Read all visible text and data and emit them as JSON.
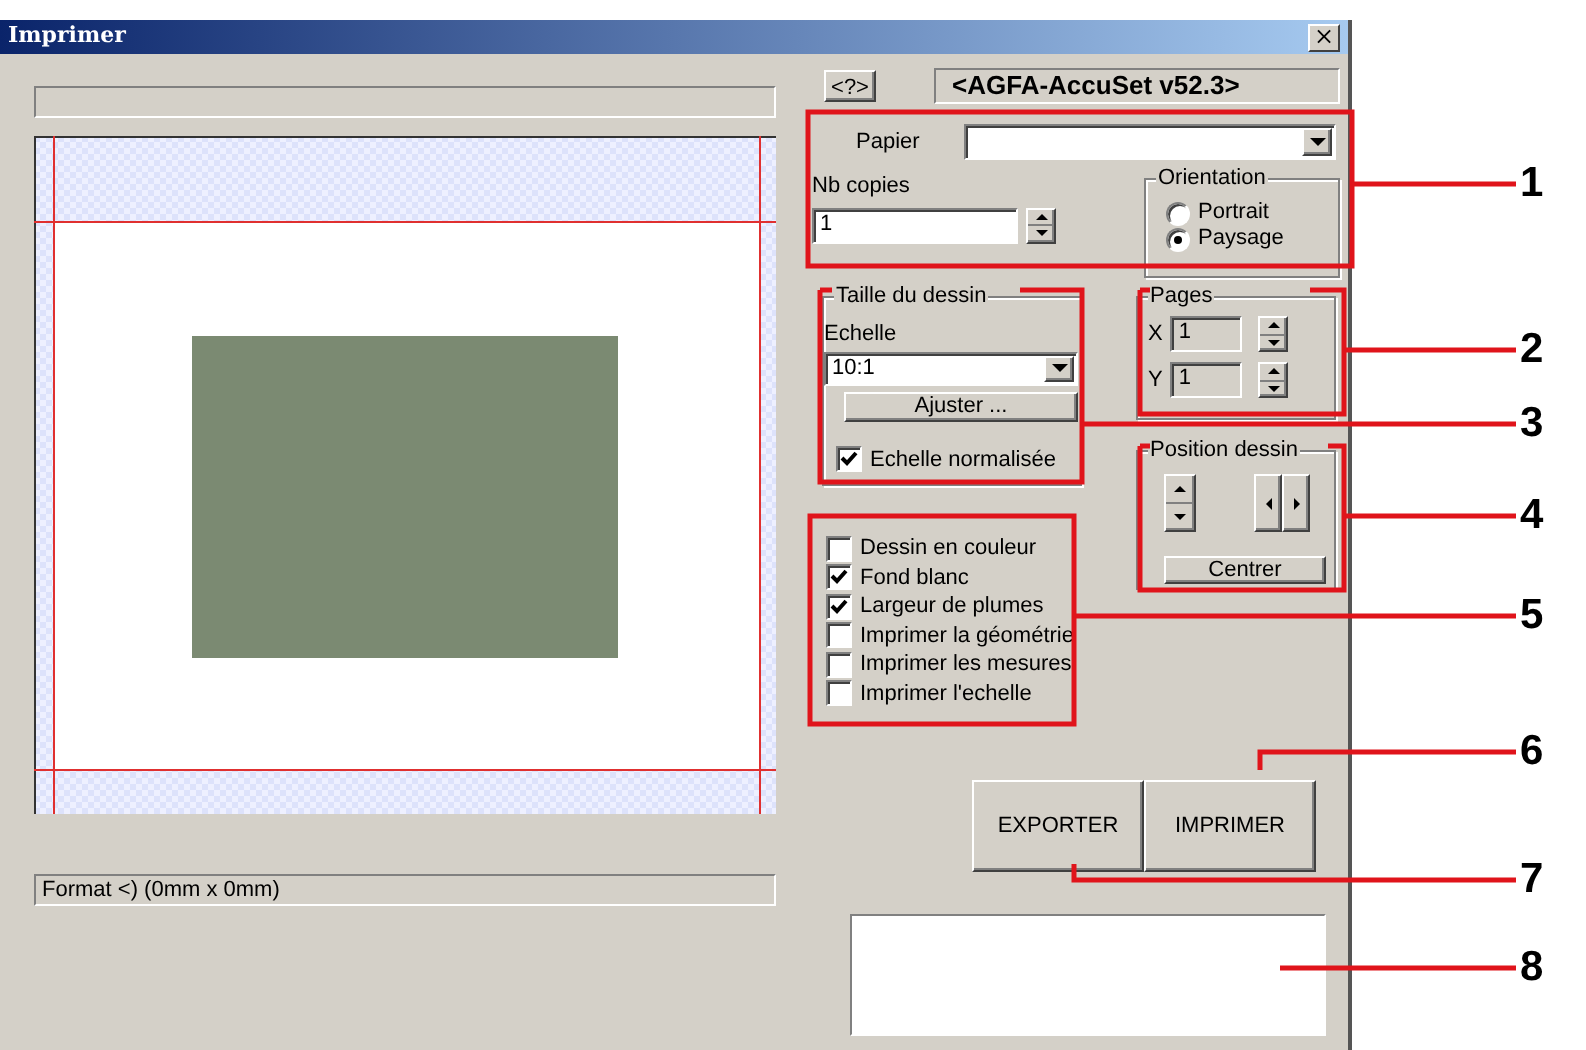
{
  "window": {
    "title": "Imprimer",
    "close": "×"
  },
  "preview": {
    "status": "Format <) (0mm x 0mm)"
  },
  "printer": {
    "help_button": "<?>",
    "name": "<AGFA-AccuSet v52.3>"
  },
  "paper": {
    "label": "Papier"
  },
  "copies": {
    "label": "Nb copies",
    "value": "1"
  },
  "orientation": {
    "title": "Orientation",
    "options": [
      {
        "label": "Portrait",
        "selected": false
      },
      {
        "label": "Paysage",
        "selected": true
      }
    ]
  },
  "drawing_size": {
    "title": "Taille du dessin",
    "scale_label": "Echelle",
    "scale_value": "10:1",
    "adjust_button": "Ajuster ...",
    "normalized": {
      "label": "Echelle normalisée",
      "checked": true
    }
  },
  "pages": {
    "title": "Pages",
    "x_label": "X",
    "x_value": "1",
    "y_label": "Y",
    "y_value": "1"
  },
  "position": {
    "title": "Position dessin",
    "center_button": "Centrer"
  },
  "options": [
    {
      "label": "Dessin en couleur",
      "checked": false
    },
    {
      "label": "Fond blanc",
      "checked": true
    },
    {
      "label": "Largeur de plumes",
      "checked": true
    },
    {
      "label": "Imprimer la géométrie",
      "checked": false
    },
    {
      "label": "Imprimer les mesures",
      "checked": false
    },
    {
      "label": "Imprimer l'echelle",
      "checked": false
    }
  ],
  "buttons": [
    {
      "label": "EXPORTER"
    },
    {
      "label": "IMPRIMER"
    }
  ],
  "callouts": [
    {
      "number": "1"
    },
    {
      "number": "2"
    },
    {
      "number": "3"
    },
    {
      "number": "4"
    },
    {
      "number": "5"
    },
    {
      "number": "6"
    },
    {
      "number": "7"
    },
    {
      "number": "8"
    }
  ]
}
